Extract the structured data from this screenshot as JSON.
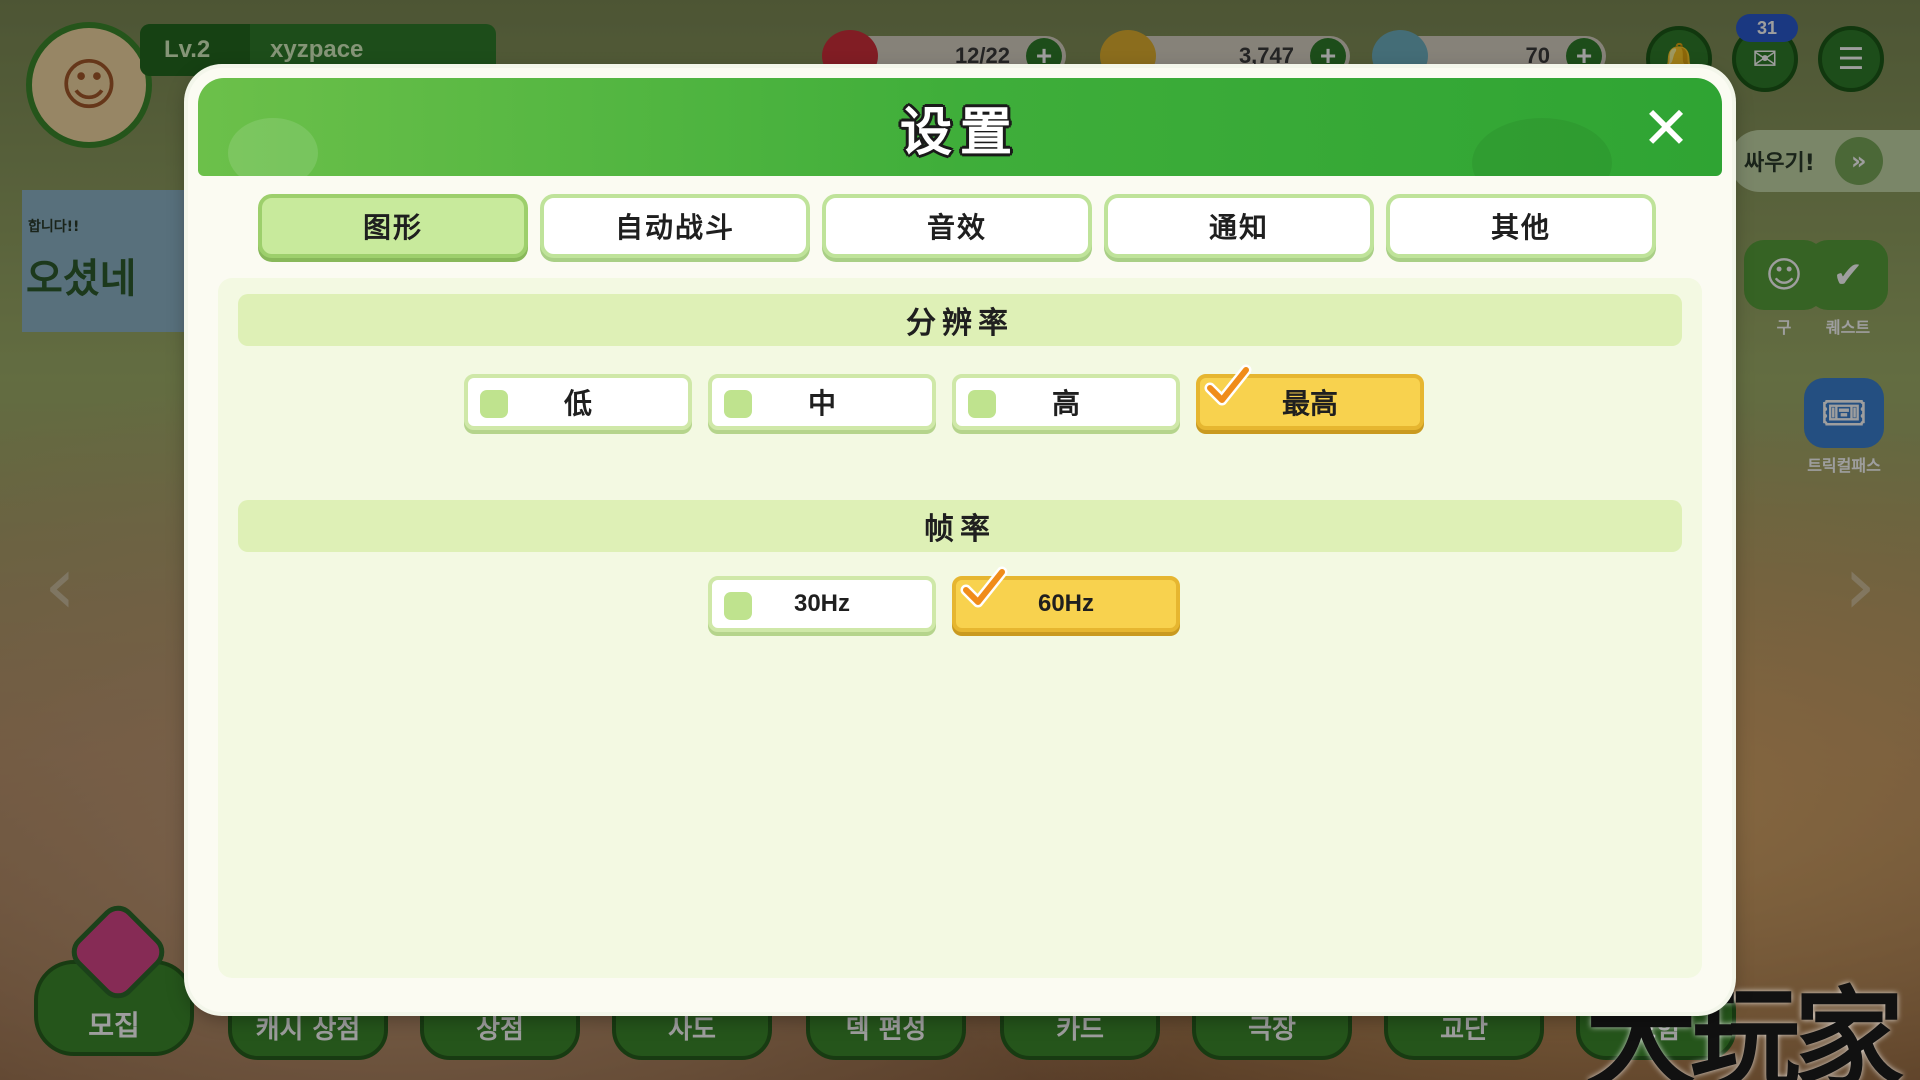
{
  "hud": {
    "level": "Lv.2",
    "username": "xyzpace",
    "stamina": "12/22",
    "gold": "3,747",
    "gems": "70",
    "mail_badge": "31"
  },
  "side": {
    "left_banner_line1": "합니다!!",
    "left_banner_line2": "오셨네",
    "fight_label": "싸우기!",
    "quest_label": "퀘스트",
    "trickcal_pass_label": "트릭컬패스",
    "friend_partial": "구"
  },
  "bottom_nav": [
    "모집",
    "캐시 상점",
    "상점",
    "사도",
    "덱 편성",
    "카드",
    "극장",
    "교단",
    "모험"
  ],
  "watermark": "大玩家",
  "settings": {
    "title": "设置",
    "tabs": [
      {
        "label": "图形",
        "active": true
      },
      {
        "label": "自动战斗",
        "active": false
      },
      {
        "label": "音效",
        "active": false
      },
      {
        "label": "通知",
        "active": false
      },
      {
        "label": "其他",
        "active": false
      }
    ],
    "resolution": {
      "header": "分辨率",
      "options": [
        "低",
        "中",
        "高",
        "最高"
      ],
      "selected": "最高"
    },
    "framerate": {
      "header": "帧率",
      "options": [
        "30Hz",
        "60Hz"
      ],
      "selected": "60Hz"
    }
  },
  "colors": {
    "header_green": "#3fae3a",
    "tab_active": "#c8ea9c",
    "option_selected": "#f8d24e",
    "section_header": "#def0b6"
  }
}
